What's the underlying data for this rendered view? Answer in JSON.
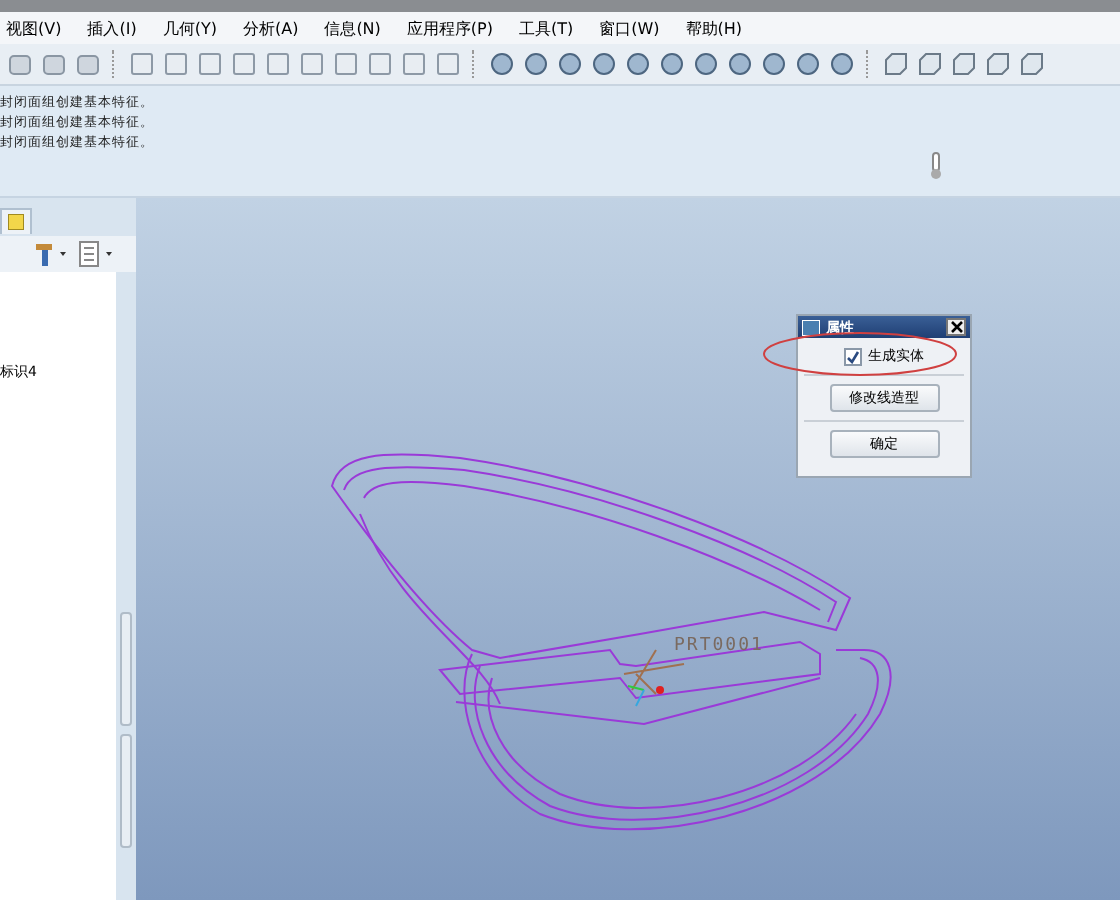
{
  "menu": [
    "视图(V)",
    "插入(I)",
    "几何(Y)",
    "分析(A)",
    "信息(N)",
    "应用程序(P)",
    "工具(T)",
    "窗口(W)",
    "帮助(H)"
  ],
  "messages": [
    "封闭面组创建基本特征。",
    "封闭面组创建基本特征。",
    "封闭面组创建基本特征。"
  ],
  "model_tree": {
    "items": [
      {
        "label": "标识4"
      }
    ]
  },
  "viewport": {
    "model_label": "PRT0001"
  },
  "dialog": {
    "title": "属性",
    "checkbox": {
      "label": "生成实体",
      "checked": true
    },
    "buttons": [
      "修改线造型",
      "确定"
    ]
  }
}
